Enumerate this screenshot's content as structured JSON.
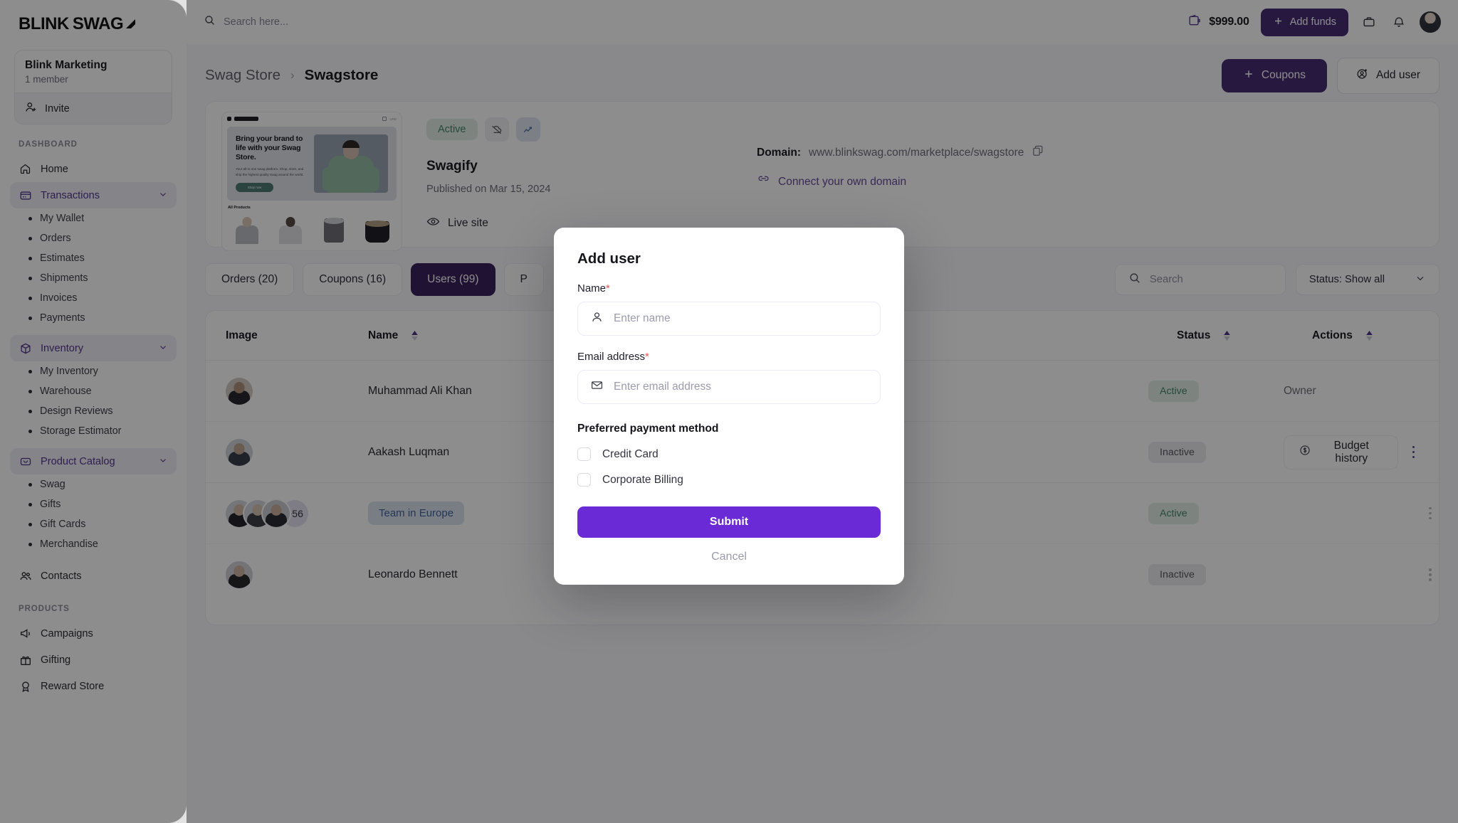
{
  "brand": {
    "part1": "BLINK",
    "part2": "SWAG",
    "mark_icon": "rocket-mark-icon"
  },
  "org": {
    "name": "Blink Marketing",
    "members": "1 member",
    "invite_label": "Invite",
    "invite_icon": "user-plus-icon"
  },
  "sidebar": {
    "sections": [
      {
        "title": "DASHBOARD",
        "items": [
          {
            "label": "Home",
            "icon": "home-icon",
            "active": false,
            "expandable": false
          },
          {
            "label": "Transactions",
            "icon": "card-icon",
            "active": true,
            "expandable": true
          },
          {
            "label": "My Wallet",
            "sub": true
          },
          {
            "label": "Orders",
            "sub": true
          },
          {
            "label": "Estimates",
            "sub": true
          },
          {
            "label": "Shipments",
            "sub": true
          },
          {
            "label": "Invoices",
            "sub": true
          },
          {
            "label": "Payments",
            "sub": true
          },
          {
            "label": "Inventory",
            "icon": "box-icon",
            "active": true,
            "expandable": true
          },
          {
            "label": "My Inventory",
            "sub": true
          },
          {
            "label": "Warehouse",
            "sub": true
          },
          {
            "label": "Design Reviews",
            "sub": true
          },
          {
            "label": "Storage Estimator",
            "sub": true
          },
          {
            "label": "Product Catalog",
            "icon": "bag-icon",
            "active": true,
            "expandable": true
          },
          {
            "label": "Swag",
            "sub": true
          },
          {
            "label": "Gifts",
            "sub": true
          },
          {
            "label": "Gift Cards",
            "sub": true
          },
          {
            "label": "Merchandise",
            "sub": true
          },
          {
            "label": "Contacts",
            "icon": "contacts-icon",
            "active": false,
            "expandable": false
          }
        ]
      },
      {
        "title": "PRODUCTS",
        "items": [
          {
            "label": "Campaigns",
            "icon": "megaphone-icon",
            "active": false,
            "expandable": false
          },
          {
            "label": "Gifting",
            "icon": "gift-icon",
            "active": false,
            "expandable": false
          },
          {
            "label": "Reward Store",
            "icon": "reward-icon",
            "active": false,
            "expandable": false
          }
        ]
      }
    ]
  },
  "topbar": {
    "search_placeholder": "Search here...",
    "search_value": "",
    "search_icon": "search-icon",
    "wallet_icon": "wallet-icon",
    "balance": "$999.00",
    "add_funds_label": "Add funds",
    "add_funds_icon": "plus-icon",
    "bag_icon": "briefcase-icon",
    "bell_icon": "bell-icon",
    "avatar_icon": "user-avatar"
  },
  "breadcrumb": {
    "parent": "Swag Store",
    "separator": "›",
    "current": "Swagstore",
    "coupons_label": "Coupons",
    "coupons_icon": "plus-icon",
    "add_user_label": "Add user",
    "add_user_icon": "user-plus-circle-icon"
  },
  "store": {
    "preview": {
      "logo_text": "logoipsum",
      "currency": "USD",
      "headline": "Bring your brand to life with your Swag Store.",
      "body": "Your all-in one swag platform. Shop, store, and ship the highest quality swag around the world.",
      "cta": "Shop now",
      "products_title": "All Products"
    },
    "status_badge": "Active",
    "cloud_icon": "cloud-off-icon",
    "analytics_icon": "chart-line-icon",
    "name": "Swagify",
    "published": "Published on Mar 15, 2024",
    "live_site_label": "Live site",
    "live_site_icon": "eye-icon",
    "domain_label": "Domain:",
    "domain_value": "www.blinkswag.com/marketplace/swagstore",
    "copy_icon": "copy-icon",
    "connect_domain_label": "Connect your own domain",
    "link_icon": "link-icon"
  },
  "tabs": [
    {
      "label": "Orders (20)",
      "selected": false
    },
    {
      "label": "Coupons (16)",
      "selected": false
    },
    {
      "label": "Users (99)",
      "selected": true
    },
    {
      "label": "P",
      "selected": false
    }
  ],
  "table_controls": {
    "search_placeholder": "Search",
    "search_value": "",
    "search_icon": "search-icon",
    "status_filter_label": "Status: Show all",
    "chevron_icon": "chevron-down-icon"
  },
  "table": {
    "columns": [
      {
        "label": "Image",
        "sortable": false
      },
      {
        "label": "Name",
        "sortable": true
      },
      {
        "label": "Status",
        "sortable": true
      },
      {
        "label": "Actions",
        "sortable": true
      }
    ],
    "rows": [
      {
        "type": "single",
        "name": "Muhammad Ali Khan",
        "status": "Active",
        "action_kind": "owner",
        "action_label": "Owner"
      },
      {
        "type": "single",
        "name": "Aakash Luqman",
        "status": "Inactive",
        "action_kind": "budget",
        "action_label": "Budget history",
        "action_icon": "dollar-circle-icon",
        "menu_icon": "kebab-menu-icon"
      },
      {
        "type": "group",
        "name": "Team in Europe",
        "extra_count": "+56",
        "status": "Active",
        "action_kind": "toggle",
        "toggle_on": true,
        "menu_icon": "kebab-menu-icon"
      },
      {
        "type": "single",
        "name": "Leonardo Bennett",
        "status": "Inactive",
        "action_kind": "toggle",
        "toggle_on": false,
        "menu_icon": "kebab-menu-icon"
      }
    ]
  },
  "modal": {
    "title": "Add user",
    "name_label": "Name",
    "name_required": "*",
    "name_placeholder": "Enter name",
    "name_value": "",
    "name_icon": "user-icon",
    "email_label": "Email address",
    "email_required": "*",
    "email_placeholder": "Enter email address",
    "email_value": "",
    "email_icon": "envelope-icon",
    "payment_title": "Preferred payment method",
    "options": [
      {
        "label": "Credit Card",
        "checked": false
      },
      {
        "label": "Corporate Billing",
        "checked": false
      }
    ],
    "submit_label": "Submit",
    "cancel_label": "Cancel"
  },
  "colors": {
    "brand_purple": "#4f1d9e",
    "submit_purple": "#6a2ad6",
    "tab_selected": "#3f1580",
    "active_green_text": "#15915b",
    "active_green_bg": "#d8f0e2",
    "link_purple": "#6b40cc",
    "required_red": "#ef5350"
  }
}
